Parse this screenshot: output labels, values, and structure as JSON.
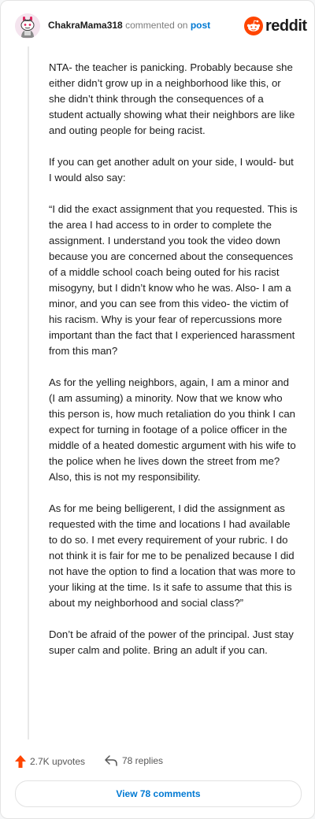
{
  "header": {
    "username": "ChakraMama318",
    "commented_text": "commented on",
    "post_link": "post",
    "logo_text": "reddit"
  },
  "comment": {
    "paragraphs": [
      "NTA- the teacher is panicking. Probably because she either didn’t grow up in a neighborhood like this, or she didn’t think through the consequences of a student actually showing what their neighbors are like and outing people for being racist.",
      "If you can get another adult on your side, I would- but I would also say:",
      "“I did the exact assignment that you requested. This is the area I had access to in order to complete the assignment. I understand you took the video down because you are concerned about the consequences of a middle school coach being outed for his racist misogyny, but I didn’t know who he was. Also- I am a minor, and you can see from this video- the victim of his racism. Why is your fear of repercussions more important than the fact that I experienced harassment from this man?",
      "As for the yelling neighbors, again, I am a minor and (I am assuming) a minority. Now that we know who this person is, how much retaliation do you think I can expect for turning in footage of a police officer in the middle of a heated domestic argument with his wife to the police when he lives down the street from me? Also, this is not my responsibility.",
      "As for me being belligerent, I did the assignment as requested with the time and locations I had available to do so. I met every requirement of your rubric. I do not think it is fair for me to be penalized because I did not have the option to find a location that was more to your liking at the time. Is it safe to assume that this is about my neighborhood and social class?”",
      "Don’t be afraid of the power of the principal. Just stay super calm and polite. Bring an adult if you can."
    ]
  },
  "footer": {
    "upvotes": "2.7K upvotes",
    "replies": "78 replies",
    "view_comments": "View 78 comments"
  },
  "colors": {
    "reddit_orange": "#ff4500",
    "link_blue": "#0079d3",
    "text": "#1c1c1c",
    "muted": "#7c7c7c"
  },
  "icons": {
    "avatar": "snoo-avatar-icon",
    "logo": "reddit-snoo-icon",
    "upvote": "upvote-arrow-icon",
    "reply": "reply-arrow-icon"
  }
}
